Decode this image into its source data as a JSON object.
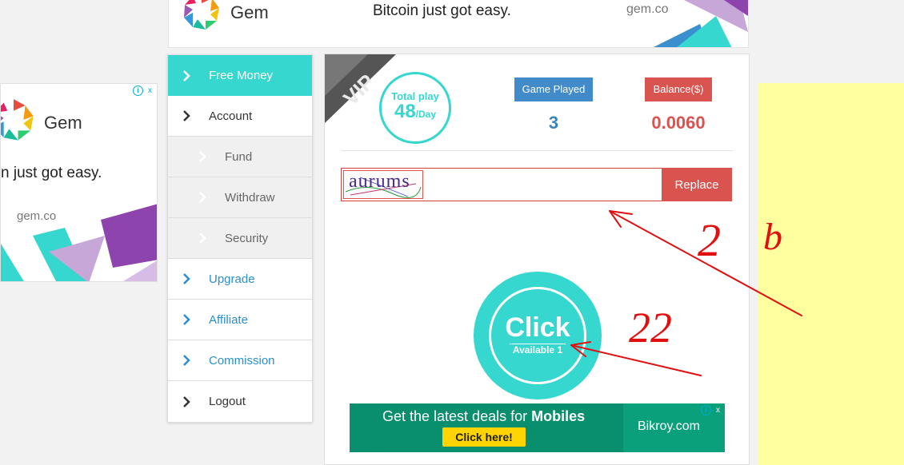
{
  "ads": {
    "top": {
      "brand": "Gem",
      "tagline": "Bitcoin just got easy.",
      "domain": "gem.co"
    },
    "left": {
      "brand": "Gem",
      "tagline": "n just got easy.",
      "domain": "gem.co"
    },
    "adchoices": {
      "info": "i",
      "close": "x"
    },
    "bottom": {
      "headline_prefix": "Get the latest deals for ",
      "headline_strong": "Mobiles",
      "cta": "Click here!",
      "logo": "Bikroy.com"
    }
  },
  "sidebar": {
    "items": [
      {
        "label": "Free Money"
      },
      {
        "label": "Account"
      },
      {
        "label": "Fund"
      },
      {
        "label": "Withdraw"
      },
      {
        "label": "Security"
      },
      {
        "label": "Upgrade"
      },
      {
        "label": "Affiliate"
      },
      {
        "label": "Commission"
      },
      {
        "label": "Logout"
      }
    ]
  },
  "main": {
    "vip_label": "VIP",
    "total_play": {
      "label": "Total play",
      "value": "48",
      "unit": "/Day"
    },
    "stats": {
      "game_played_label": "Game Played",
      "game_played_value": "3",
      "balance_label": "Balance($)",
      "balance_value": "0.0060"
    },
    "captcha": {
      "text": "aurums",
      "input_value": "",
      "replace_label": "Replace"
    },
    "click": {
      "label": "Click",
      "available": "Available 1"
    }
  },
  "annotations": {
    "marks": [
      "2",
      "b",
      "22"
    ]
  },
  "colors": {
    "teal": "#36d7cf",
    "red": "#d9534f",
    "blue_badge": "#428bca",
    "yellow": "#ffffa0",
    "annotation": "#e01010"
  }
}
